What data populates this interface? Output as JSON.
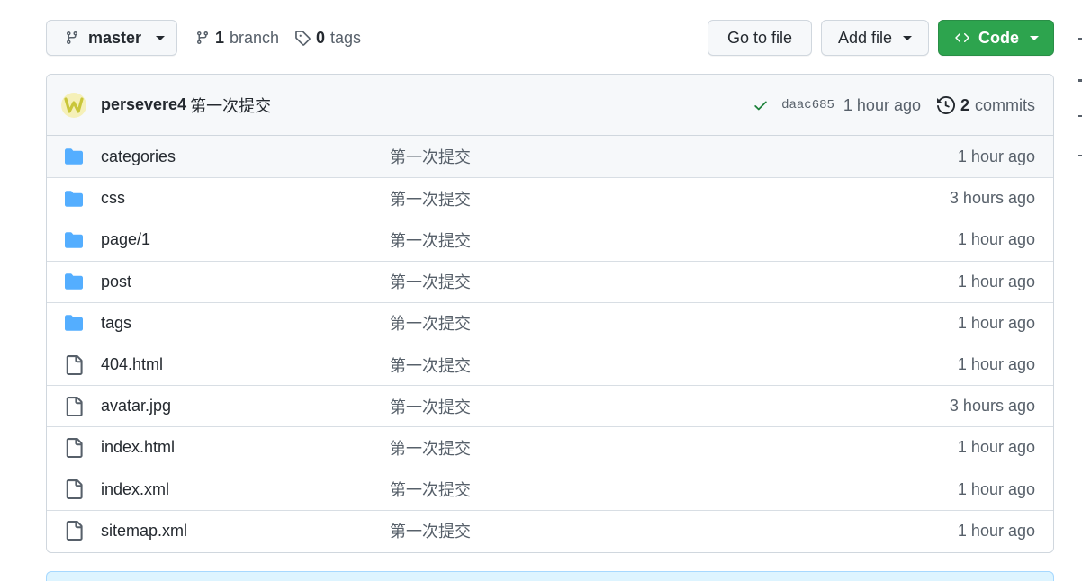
{
  "toolbar": {
    "branch_name": "master",
    "branch_count": "1",
    "branch_label": "branch",
    "tag_count": "0",
    "tag_label": "tags",
    "goto_file": "Go to file",
    "add_file": "Add file",
    "code": "Code"
  },
  "latest_commit": {
    "author": "persevere4",
    "message": "第一次提交",
    "sha": "daac685",
    "time": "1 hour ago",
    "commit_count": "2",
    "commit_label": "commits",
    "status": "success"
  },
  "files": [
    {
      "type": "folder",
      "name": "categories",
      "message": "第一次提交",
      "age": "1 hour ago"
    },
    {
      "type": "folder",
      "name": "css",
      "message": "第一次提交",
      "age": "3 hours ago"
    },
    {
      "type": "folder",
      "name": "page/1",
      "message": "第一次提交",
      "age": "1 hour ago"
    },
    {
      "type": "folder",
      "name": "post",
      "message": "第一次提交",
      "age": "1 hour ago"
    },
    {
      "type": "folder",
      "name": "tags",
      "message": "第一次提交",
      "age": "1 hour ago"
    },
    {
      "type": "file",
      "name": "404.html",
      "message": "第一次提交",
      "age": "1 hour ago"
    },
    {
      "type": "file",
      "name": "avatar.jpg",
      "message": "第一次提交",
      "age": "3 hours ago"
    },
    {
      "type": "file",
      "name": "index.html",
      "message": "第一次提交",
      "age": "1 hour ago"
    },
    {
      "type": "file",
      "name": "index.xml",
      "message": "第一次提交",
      "age": "1 hour ago"
    },
    {
      "type": "file",
      "name": "sitemap.xml",
      "message": "第一次提交",
      "age": "1 hour ago"
    }
  ],
  "colors": {
    "accent_green": "#2da44e",
    "folder_blue": "#54aeff",
    "check_green": "#1a7f37",
    "muted_text": "#57606a"
  },
  "icons": {
    "branch": "git-branch-icon",
    "tag": "tag-icon",
    "code": "code-icon",
    "check": "check-icon",
    "history": "history-icon",
    "folder": "folder-icon",
    "file": "file-icon"
  }
}
